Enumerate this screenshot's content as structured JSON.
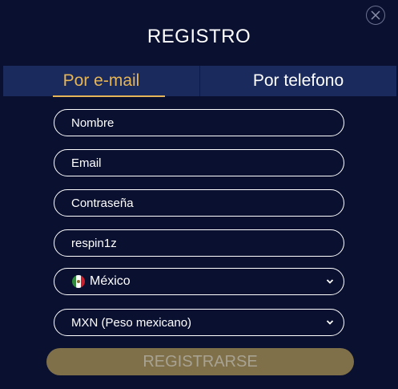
{
  "modal": {
    "title": "REGISTRO",
    "close_icon": "close-icon"
  },
  "tabs": [
    {
      "label": "Por e-mail",
      "active": true
    },
    {
      "label": "Por telefono",
      "active": false
    }
  ],
  "form": {
    "name": {
      "placeholder": "Nombre",
      "value": ""
    },
    "email": {
      "placeholder": "Email",
      "value": ""
    },
    "password": {
      "placeholder": "Contraseña",
      "value": ""
    },
    "promo": {
      "value": "respin1z"
    },
    "country": {
      "value": "México",
      "flag_icon": "mexico-flag-icon"
    },
    "currency": {
      "value": "MXN (Peso mexicano)"
    },
    "submit_label": "REGISTRARSE"
  },
  "colors": {
    "background": "#0a1030",
    "tab_bar": "#1a2a5c",
    "accent": "#e5b557",
    "submit_bg": "#7f7049"
  }
}
